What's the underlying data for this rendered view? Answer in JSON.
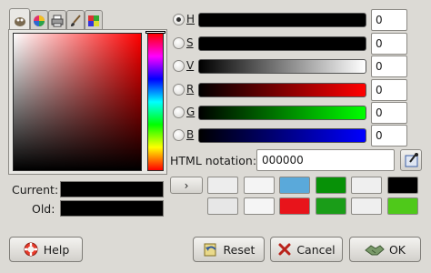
{
  "window": {
    "title": ""
  },
  "tabs": [
    {
      "name": "gimp-wilber",
      "icon": "wilber-icon"
    },
    {
      "name": "color-wheel",
      "icon": "color-wheel-icon"
    },
    {
      "name": "printer",
      "icon": "printer-icon"
    },
    {
      "name": "brush",
      "icon": "brush-icon"
    },
    {
      "name": "palette",
      "icon": "palette-icon"
    }
  ],
  "current_label": "Current:",
  "old_label": "Old:",
  "current_color": "#000000",
  "old_color": "#000000",
  "channels": [
    {
      "key": "H",
      "label": "H",
      "value": "0",
      "checked": true
    },
    {
      "key": "S",
      "label": "S",
      "value": "0",
      "checked": false
    },
    {
      "key": "V",
      "label": "V",
      "value": "0",
      "checked": false
    },
    {
      "key": "R",
      "label": "R",
      "value": "0",
      "checked": false
    },
    {
      "key": "G",
      "label": "G",
      "value": "0",
      "checked": false
    },
    {
      "key": "B",
      "label": "B",
      "value": "0",
      "checked": false
    }
  ],
  "html_notation_label": "HTML notation:",
  "html_notation_value": "000000",
  "history_arrow": "›",
  "history": [
    [
      "#ededed",
      "#f4f4f4",
      "#5aa9da",
      "#079107",
      "#efefef",
      "#000000"
    ],
    [
      "#e7e7e7",
      "#f5f5f5",
      "#e8141b",
      "#1a9d18",
      "#efefef",
      "#4fc91a"
    ]
  ],
  "buttons": {
    "help": "Help",
    "reset": "Reset",
    "cancel": "Cancel",
    "ok": "OK"
  }
}
